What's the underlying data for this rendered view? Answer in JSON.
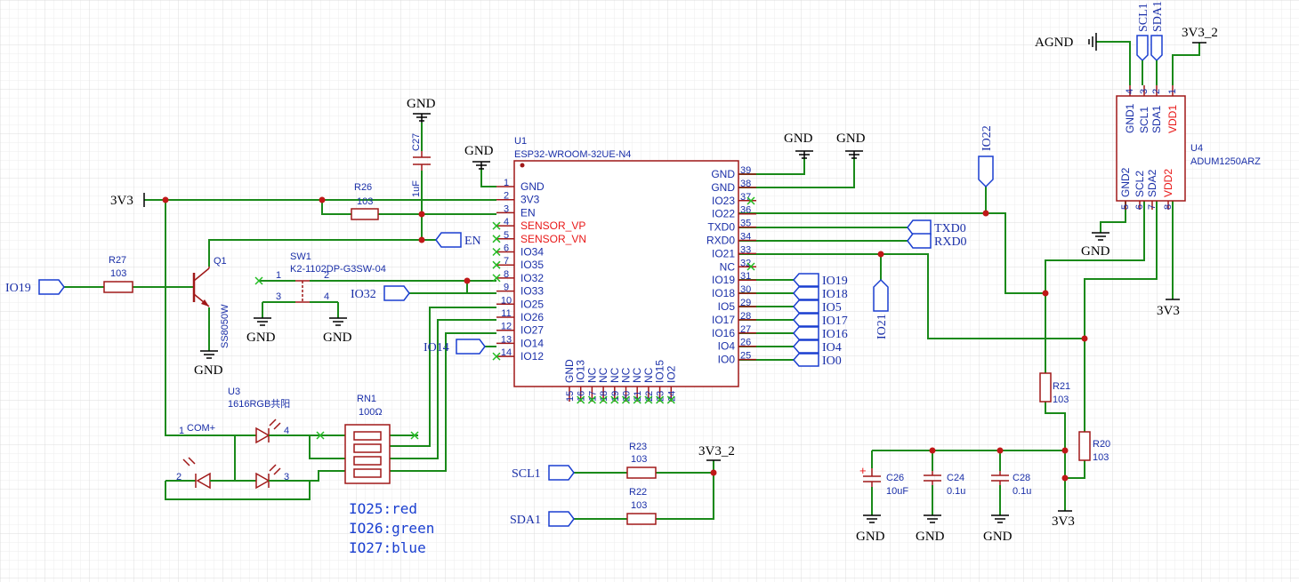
{
  "power": {
    "gnd": "GND",
    "v3v3": "3V3",
    "v3v3_2": "3V3_2",
    "agnd": "AGND"
  },
  "u1": {
    "ref": "U1",
    "part": "ESP32-WROOM-32UE-N4",
    "left_pins": [
      {
        "num": "1",
        "name": "GND"
      },
      {
        "num": "2",
        "name": "3V3"
      },
      {
        "num": "3",
        "name": "EN"
      },
      {
        "num": "4",
        "name": "SENSOR_VP"
      },
      {
        "num": "5",
        "name": "SENSOR_VN"
      },
      {
        "num": "6",
        "name": "IO34"
      },
      {
        "num": "7",
        "name": "IO35"
      },
      {
        "num": "8",
        "name": "IO32"
      },
      {
        "num": "9",
        "name": "IO33"
      },
      {
        "num": "10",
        "name": "IO25"
      },
      {
        "num": "11",
        "name": "IO26"
      },
      {
        "num": "12",
        "name": "IO27"
      },
      {
        "num": "13",
        "name": "IO14"
      },
      {
        "num": "14",
        "name": "IO12"
      }
    ],
    "right_pins": [
      {
        "num": "39",
        "name": "GND"
      },
      {
        "num": "38",
        "name": "GND"
      },
      {
        "num": "37",
        "name": "IO23"
      },
      {
        "num": "36",
        "name": "IO22"
      },
      {
        "num": "35",
        "name": "TXD0"
      },
      {
        "num": "34",
        "name": "RXD0"
      },
      {
        "num": "33",
        "name": "IO21"
      },
      {
        "num": "32",
        "name": "NC"
      },
      {
        "num": "31",
        "name": "IO19"
      },
      {
        "num": "30",
        "name": "IO18"
      },
      {
        "num": "29",
        "name": "IO5"
      },
      {
        "num": "28",
        "name": "IO17"
      },
      {
        "num": "27",
        "name": "IO16"
      },
      {
        "num": "26",
        "name": "IO4"
      },
      {
        "num": "25",
        "name": "IO0"
      }
    ],
    "bottom_pins": [
      {
        "num": "15",
        "name": "GND"
      },
      {
        "num": "16",
        "name": "IO13"
      },
      {
        "num": "17",
        "name": "NC"
      },
      {
        "num": "18",
        "name": "NC"
      },
      {
        "num": "19",
        "name": "NC"
      },
      {
        "num": "20",
        "name": "NC"
      },
      {
        "num": "21",
        "name": "NC"
      },
      {
        "num": "22",
        "name": "NC"
      },
      {
        "num": "23",
        "name": "IO15"
      },
      {
        "num": "24",
        "name": "IO2"
      }
    ]
  },
  "u4": {
    "ref": "U4",
    "part": "ADUM1250ARZ",
    "top_pins": [
      {
        "num": "4",
        "name": "GND1"
      },
      {
        "num": "3",
        "name": "SCL1"
      },
      {
        "num": "2",
        "name": "SDA1"
      },
      {
        "num": "1",
        "name": "VDD1"
      }
    ],
    "bottom_pins": [
      {
        "num": "5",
        "name": "GND2"
      },
      {
        "num": "6",
        "name": "SCL2"
      },
      {
        "num": "7",
        "name": "SDA2"
      },
      {
        "num": "8",
        "name": "VDD2"
      }
    ]
  },
  "components": {
    "r26": {
      "ref": "R26",
      "value": "103"
    },
    "r27": {
      "ref": "R27",
      "value": "103"
    },
    "r21": {
      "ref": "R21",
      "value": "103"
    },
    "r20": {
      "ref": "R20",
      "value": "103"
    },
    "r23": {
      "ref": "R23",
      "value": "103"
    },
    "r22": {
      "ref": "R22",
      "value": "103"
    },
    "c27": {
      "ref": "C27",
      "value": "1uF"
    },
    "c26": {
      "ref": "C26",
      "value": "10uF"
    },
    "c24": {
      "ref": "C24",
      "value": "0.1u"
    },
    "c28": {
      "ref": "C28",
      "value": "0.1u"
    },
    "q1": {
      "ref": "Q1",
      "value": "SS8050W"
    },
    "sw1": {
      "ref": "SW1",
      "value": "K2-1102DP-G3SW-04",
      "pins": [
        "1",
        "2",
        "3",
        "4"
      ]
    },
    "u3": {
      "ref": "U3",
      "value": "1616RGB共阳",
      "com": "COM+",
      "pins": [
        "1",
        "2",
        "3",
        "4"
      ]
    },
    "rn1": {
      "ref": "RN1",
      "value": "100Ω"
    }
  },
  "flags": {
    "io19": "IO19",
    "en": "EN",
    "io32": "IO32",
    "io14": "IO14",
    "io22": "IO22",
    "io21": "IO21",
    "txd0": "TXD0",
    "rxd0": "RXD0",
    "io19_r": "IO19",
    "io18": "IO18",
    "io5": "IO5",
    "io17": "IO17",
    "io16": "IO16",
    "io4": "IO4",
    "io0": "IO0",
    "scl1": "SCL1",
    "sda1": "SDA1",
    "scl_top": "SCL1",
    "sda_top": "SDA1"
  },
  "notes": [
    "IO25:red",
    "IO26:green",
    "IO27:blue"
  ]
}
